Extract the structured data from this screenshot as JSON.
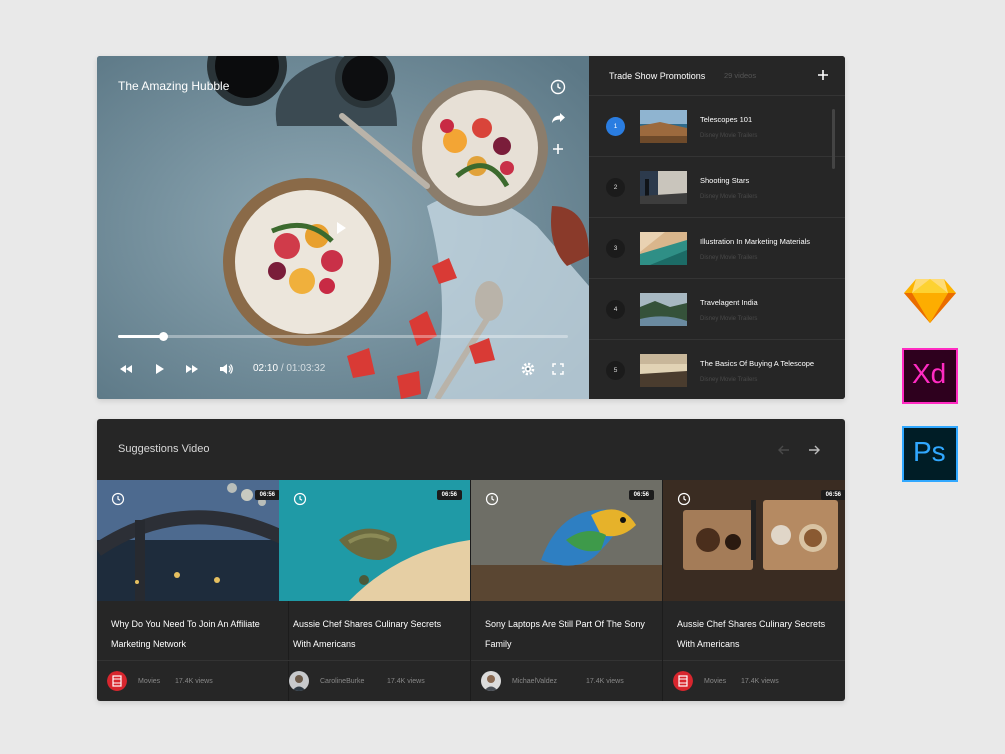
{
  "player": {
    "title": "The Amazing Hubble",
    "progress_fraction": 0.1,
    "current_time": "02:10",
    "duration": "01:03:32",
    "time_separator": "/",
    "icons": [
      "clock-icon",
      "share-icon",
      "plus-icon",
      "play-icon",
      "rewind-icon",
      "fast-forward-icon",
      "volume-icon",
      "settings-icon",
      "fullscreen-icon"
    ]
  },
  "playlist": {
    "title": "Trade Show Promotions",
    "count": "29 videos",
    "items": [
      {
        "num": "1",
        "title": "Telescopes 101",
        "sub": "Disney Movie Trailers",
        "active": true
      },
      {
        "num": "2",
        "title": "Shooting Stars",
        "sub": "Disney Movie Trailers",
        "active": false
      },
      {
        "num": "3",
        "title": "Illustration In Marketing Materials",
        "sub": "Disney Movie Trailers",
        "active": false
      },
      {
        "num": "4",
        "title": "Travelagent India",
        "sub": "Disney Movie Trailers",
        "active": false
      },
      {
        "num": "5",
        "title": "The Basics Of Buying A Telescope",
        "sub": "Disney Movie Trailers",
        "active": false
      }
    ]
  },
  "suggestions": {
    "title": "Suggestions Video",
    "cards": [
      {
        "duration": "06:56",
        "title": "Why Do You Need To Join An Affiliate Marketing Network",
        "author": "Movies",
        "views": "17.4K views"
      },
      {
        "duration": "06:56",
        "title": "Aussie Chef Shares Culinary Secrets With Americans",
        "author": "CarolineBurke",
        "views": "17.4K views"
      },
      {
        "duration": "06:56",
        "title": "Sony Laptops Are Still Part Of The Sony Family",
        "author": "MichaelValdez",
        "views": "17.4K views"
      },
      {
        "duration": "06:56",
        "title": "Aussie Chef Shares Culinary Secrets With Americans",
        "author": "Movies",
        "views": "17.4K views"
      }
    ]
  },
  "apps": {
    "sketch": "",
    "xd": "Xd",
    "ps": "Ps"
  },
  "colors": {
    "accent": "#2a7de1",
    "panel": "#262626",
    "background": "#e9e9e9",
    "xd_border": "#ff2bc2",
    "ps_border": "#31a8ff"
  }
}
